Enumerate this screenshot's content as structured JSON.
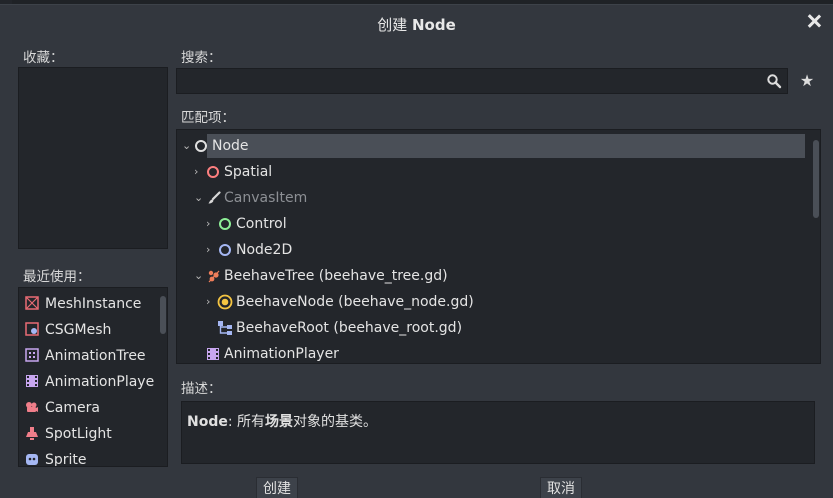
{
  "dialog": {
    "title_prefix": "创建",
    "title_bold": "Node"
  },
  "favorites": {
    "label": "收藏："
  },
  "recent": {
    "label": "最近使用：",
    "items": [
      {
        "label": "MeshInstance",
        "icon": "mesh-instance-icon",
        "color": "#e96b74"
      },
      {
        "label": "CSGMesh",
        "icon": "csg-mesh-icon",
        "color": "#e96b74"
      },
      {
        "label": "AnimationTree",
        "icon": "animation-tree-icon",
        "color": "#c8a6f0"
      },
      {
        "label": "AnimationPlaye",
        "icon": "animation-player-icon",
        "color": "#c8a6f0"
      },
      {
        "label": "Camera",
        "icon": "camera-icon",
        "color": "#f07e8a"
      },
      {
        "label": "SpotLight",
        "icon": "spotlight-icon",
        "color": "#f07e8a"
      },
      {
        "label": "Sprite",
        "icon": "sprite-icon",
        "color": "#a5b7f3"
      }
    ]
  },
  "search": {
    "label": "搜索：",
    "value": "",
    "placeholder": ""
  },
  "matches": {
    "label": "匹配项：",
    "rows": [
      {
        "label": "Node",
        "icon": "node-circle-icon",
        "color": "#e0e0e0",
        "expanded": true,
        "selected": true
      },
      {
        "label": "Spatial",
        "icon": "spatial-circle-icon",
        "color": "#fc7f7f",
        "expanded": false
      },
      {
        "label": "CanvasItem",
        "icon": "brush-icon",
        "color": "#e0e0e0",
        "expanded": true,
        "disabled": true
      },
      {
        "label": "Control",
        "icon": "control-circle-icon",
        "color": "#8eef97",
        "expanded": false
      },
      {
        "label": "Node2D",
        "icon": "node2d-circle-icon",
        "color": "#a5b7f3",
        "expanded": false
      },
      {
        "label": "BeehaveTree (beehave_tree.gd)",
        "icon": "beehave-tree-icon",
        "color": "#f07e5a",
        "expanded": true
      },
      {
        "label": "BeehaveNode (beehave_node.gd)",
        "icon": "beehave-node-icon",
        "color": "#f5c542",
        "expanded": false
      },
      {
        "label": "BeehaveRoot (beehave_root.gd)",
        "icon": "beehave-root-icon",
        "color": "#a5b7f3"
      },
      {
        "label": "AnimationPlayer",
        "icon": "animation-player-icon",
        "color": "#c8a6f0"
      }
    ]
  },
  "description": {
    "label": "描述：",
    "node_name": "Node",
    "text_before": ": 所有",
    "text_bold": "场景",
    "text_after": "对象的基类。"
  },
  "buttons": {
    "create": "创建",
    "cancel": "取消"
  }
}
